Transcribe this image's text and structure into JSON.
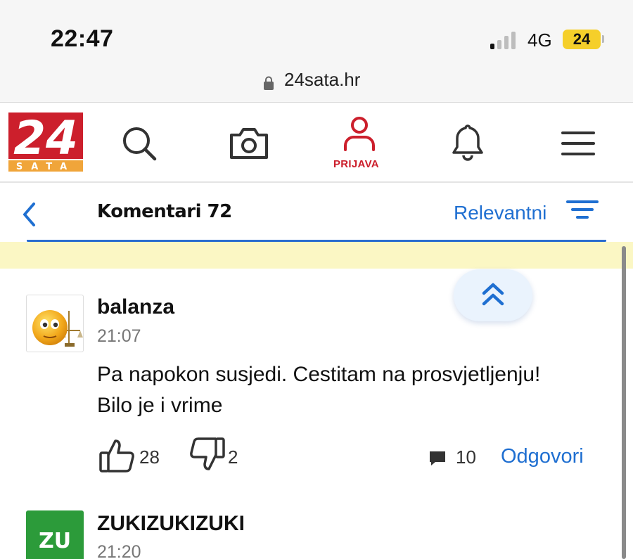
{
  "status_bar": {
    "time": "22:47",
    "network": "4G",
    "battery": "24"
  },
  "browser": {
    "url": "24sata.hr"
  },
  "header": {
    "logo_text_top": "24",
    "logo_text_bottom": "SATA",
    "login_label": "PRIJAVA",
    "icons": [
      "search-icon",
      "camera-icon",
      "user-icon",
      "bell-icon",
      "menu-icon"
    ]
  },
  "comments_bar": {
    "title": "Komentari 72",
    "sort_label": "Relevantni"
  },
  "comments": [
    {
      "username": "balanza",
      "time": "21:07",
      "text_line1": "Pa napokon susjedi. Cestitam na prosvjetljenju!",
      "text_line2": "Bilo je i vrime",
      "likes": "28",
      "dislikes": "2",
      "replies": "10",
      "reply_label": "Odgovori"
    },
    {
      "username": "ZUKIZUKIZUKI",
      "time": "21:20",
      "avatar_initials": "ZU"
    }
  ],
  "colors": {
    "brand_red": "#cc1f2c",
    "link_blue": "#1f6fd1",
    "highlight_yellow": "#fbf7c4",
    "avatar_green": "#2c9b3a",
    "battery_yellow": "#f5cf2a"
  }
}
